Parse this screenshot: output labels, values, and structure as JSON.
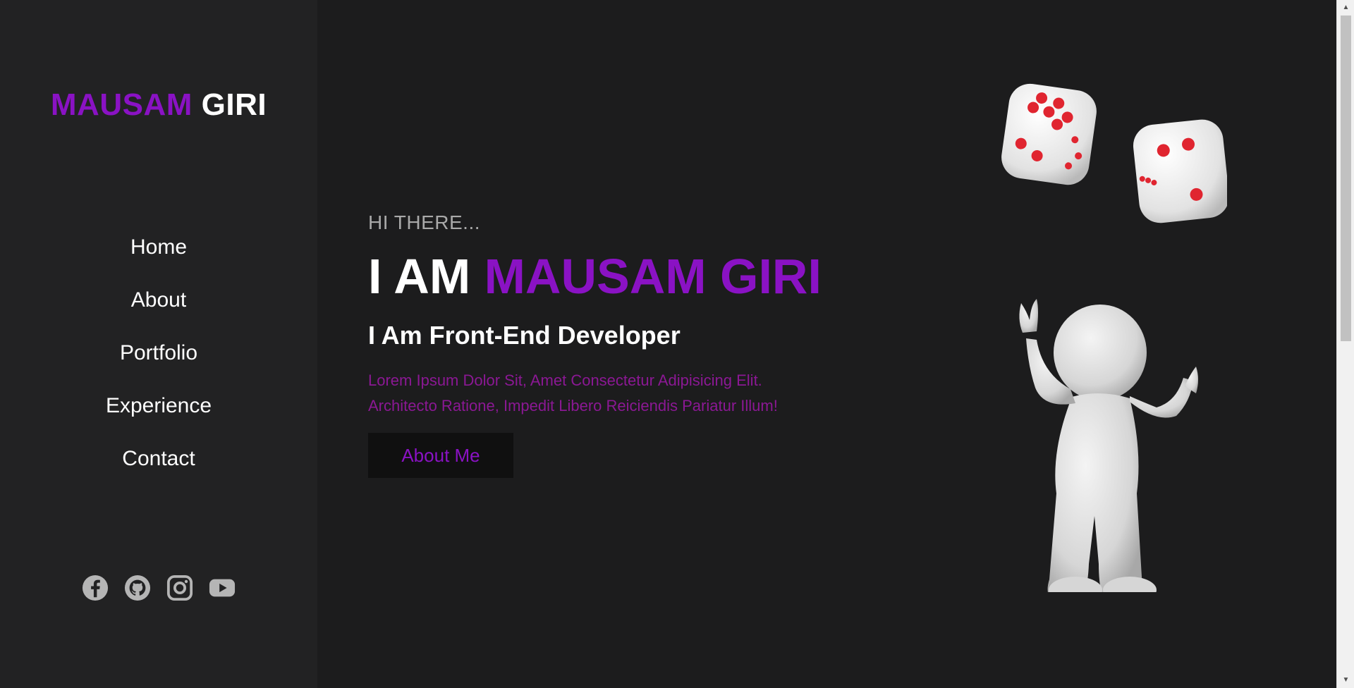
{
  "sidebar": {
    "logo": {
      "first": "MAUSAM",
      "last": "GIRI"
    },
    "nav": [
      {
        "label": "Home"
      },
      {
        "label": "About"
      },
      {
        "label": "Portfolio"
      },
      {
        "label": "Experience"
      },
      {
        "label": "Contact"
      }
    ],
    "socials": [
      {
        "icon": "facebook-icon"
      },
      {
        "icon": "github-icon"
      },
      {
        "icon": "instagram-icon"
      },
      {
        "icon": "youtube-icon"
      }
    ]
  },
  "hero": {
    "greeting": "HI THERE...",
    "headline_prefix": "I AM",
    "headline_name": "MAUSAM GIRI",
    "role": "I Am Front-End Developer",
    "description_line1": "Lorem Ipsum Dolor Sit, Amet Consectetur Adipisicing Elit.",
    "description_line2": "Architecto Ratione, Impedit Libero Reiciendis Pariatur Illum!",
    "button_label": "About Me"
  },
  "colors": {
    "accent": "#8a12c4",
    "description": "#8b1894",
    "background": "#1c1c1d",
    "sidebar": "#222223"
  }
}
